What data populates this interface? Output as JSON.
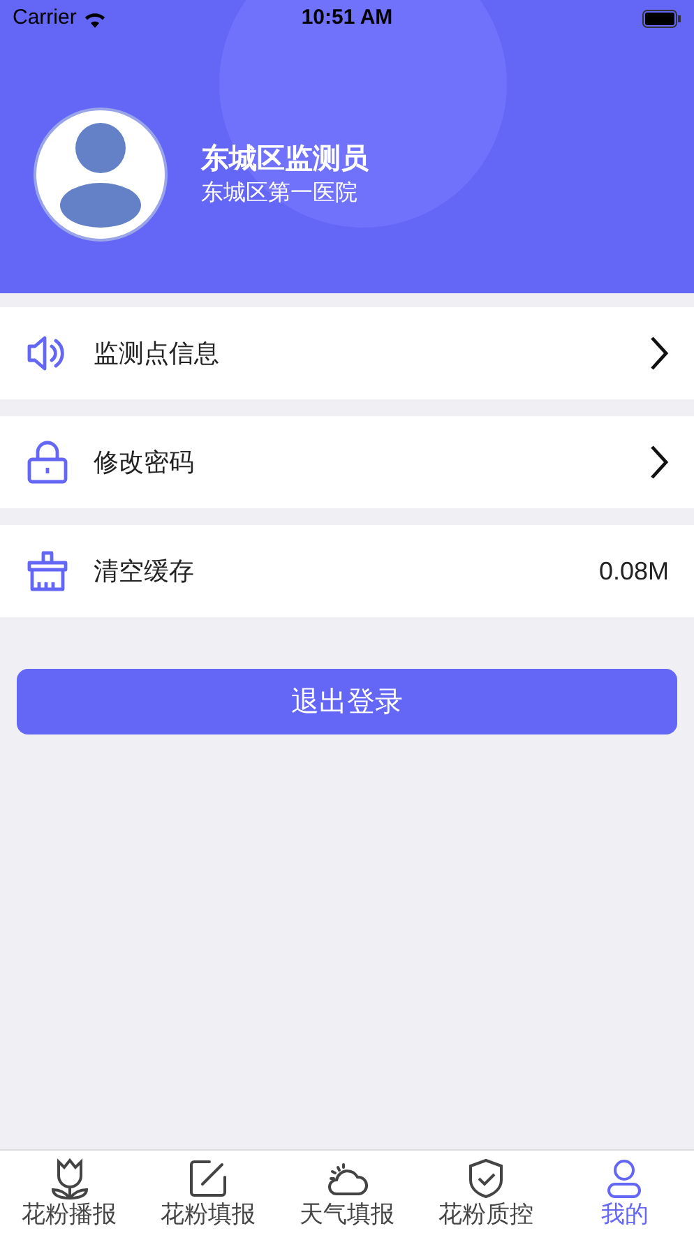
{
  "status_bar": {
    "carrier": "Carrier",
    "time": "10:51 AM"
  },
  "profile": {
    "name": "东城区监测员",
    "organization": "东城区第一医院"
  },
  "menu": [
    {
      "label": "监测点信息",
      "kind": "link"
    },
    {
      "label": "修改密码",
      "kind": "link"
    },
    {
      "label": "清空缓存",
      "kind": "value",
      "value": "0.08M"
    }
  ],
  "logout_button": "退出登录",
  "tabs": [
    {
      "label": "花粉播报",
      "selected": false
    },
    {
      "label": "花粉填报",
      "selected": false
    },
    {
      "label": "天气填报",
      "selected": false
    },
    {
      "label": "花粉质控",
      "selected": false
    },
    {
      "label": "我的",
      "selected": true
    }
  ]
}
